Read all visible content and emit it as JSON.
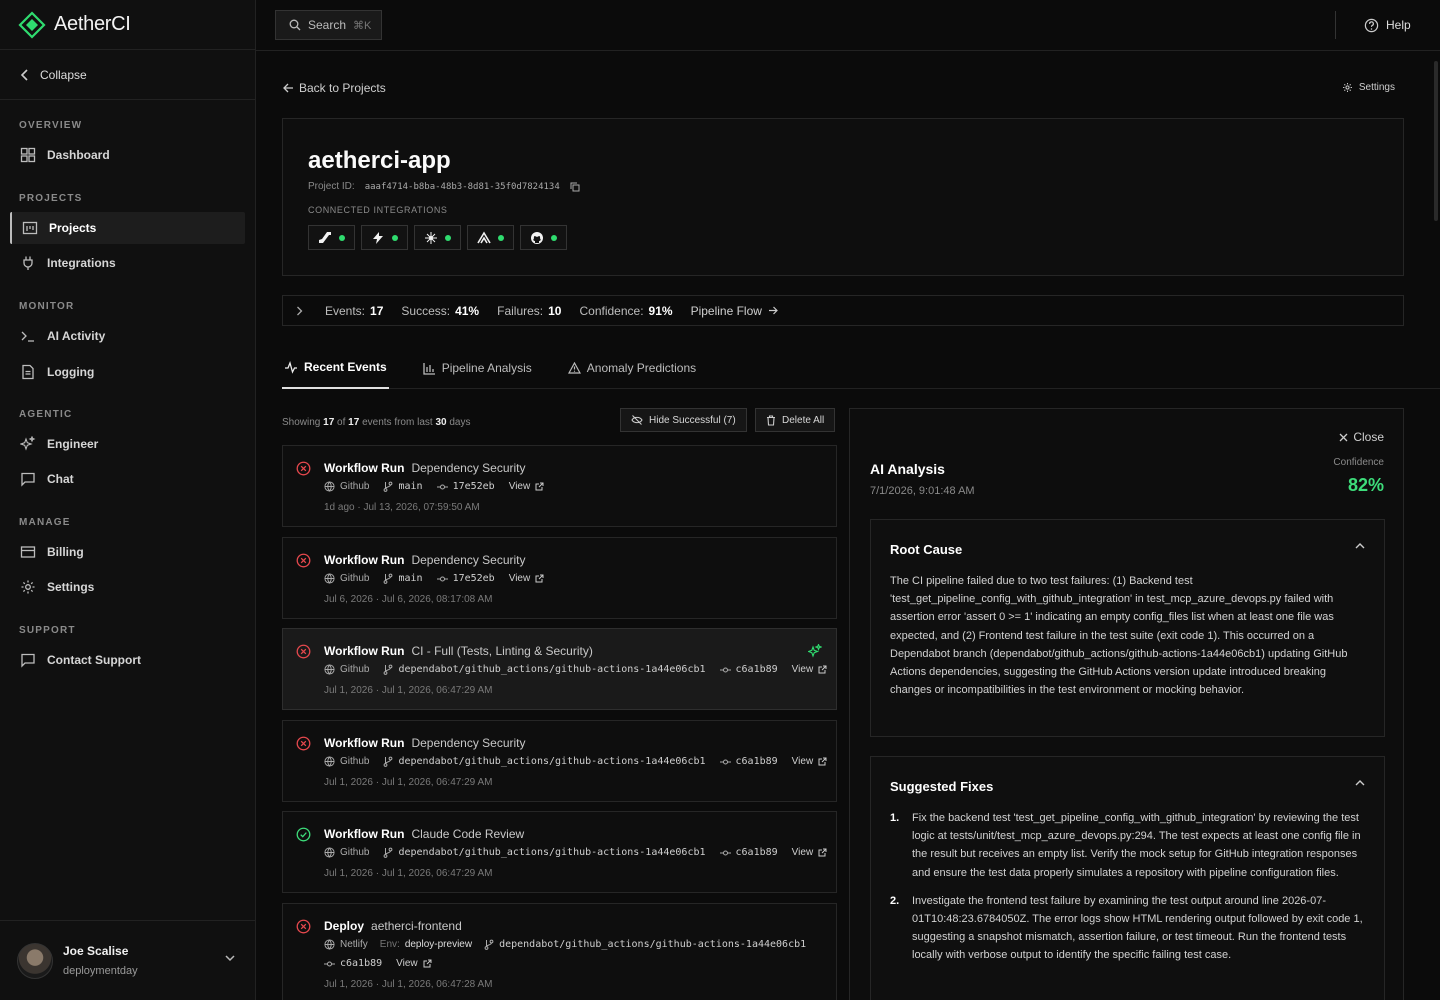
{
  "brand": {
    "name": "AetherCI",
    "logo_icon": "diamond-logo-icon",
    "accent": "#2fdc6f"
  },
  "sidebar": {
    "collapse_label": "Collapse",
    "sections": [
      {
        "heading": "OVERVIEW",
        "items": [
          {
            "label": "Dashboard",
            "icon": "dashboard-icon"
          }
        ]
      },
      {
        "heading": "PROJECTS",
        "items": [
          {
            "label": "Projects",
            "icon": "projects-icon",
            "active": true
          },
          {
            "label": "Integrations",
            "icon": "plug-icon"
          }
        ]
      },
      {
        "heading": "MONITOR",
        "items": [
          {
            "label": "AI Activity",
            "icon": "terminal-icon"
          },
          {
            "label": "Logging",
            "icon": "document-icon"
          }
        ]
      },
      {
        "heading": "AGENTIC",
        "items": [
          {
            "label": "Engineer",
            "icon": "sparkle-icon"
          },
          {
            "label": "Chat",
            "icon": "chat-icon"
          }
        ]
      },
      {
        "heading": "MANAGE",
        "items": [
          {
            "label": "Billing",
            "icon": "card-icon"
          },
          {
            "label": "Settings",
            "icon": "gear-icon"
          }
        ]
      },
      {
        "heading": "SUPPORT",
        "items": [
          {
            "label": "Contact Support",
            "icon": "message-icon"
          }
        ]
      }
    ],
    "user": {
      "name": "Joe Scalise",
      "workspace": "deploymentday"
    }
  },
  "topbar": {
    "search_label": "Search",
    "search_shortcut": "⌘K",
    "help_label": "Help"
  },
  "page": {
    "back_label": "Back to Projects",
    "settings_label": "Settings",
    "project": {
      "name": "aetherci-app",
      "id_label": "Project ID:",
      "id_value": "aaaf4714-b8ba-48b3-8d81-35f0d7824134",
      "integrations_label": "CONNECTED INTEGRATIONS",
      "integrations": [
        {
          "icon": "azure-devops-icon",
          "status": "connected"
        },
        {
          "icon": "bolt-icon",
          "status": "connected"
        },
        {
          "icon": "spark-icon",
          "status": "connected"
        },
        {
          "icon": "sentry-icon",
          "status": "connected"
        },
        {
          "icon": "github-icon",
          "status": "connected"
        }
      ]
    },
    "stats": {
      "events_label": "Events:",
      "events_value": "17",
      "success_label": "Success:",
      "success_value": "41%",
      "failures_label": "Failures:",
      "failures_value": "10",
      "confidence_label": "Confidence:",
      "confidence_value": "91%",
      "pipeline_flow_label": "Pipeline Flow"
    },
    "tabs": [
      {
        "label": "Recent Events",
        "icon": "activity-icon",
        "active": true
      },
      {
        "label": "Pipeline Analysis",
        "icon": "bar-chart-icon"
      },
      {
        "label": "Anomaly Predictions",
        "icon": "warning-icon"
      }
    ],
    "list": {
      "showing_prefix": "Showing",
      "showing_count": "17",
      "showing_of": "of",
      "showing_total": "17",
      "showing_mid": "events from last",
      "showing_days": "30",
      "showing_suffix": "days",
      "hide_successful_label": "Hide Successful (7)",
      "delete_all_label": "Delete All"
    },
    "events": [
      {
        "status": "failed",
        "type": "Workflow Run",
        "name": "Dependency Security",
        "provider": "Github",
        "branch": "main",
        "commit": "17e52eb",
        "view": "View",
        "relative": "1d ago",
        "timestamp": "Jul 13, 2026, 07:59:50 AM"
      },
      {
        "status": "failed",
        "type": "Workflow Run",
        "name": "Dependency Security",
        "provider": "Github",
        "branch": "main",
        "commit": "17e52eb",
        "view": "View",
        "relative": "Jul 6, 2026",
        "timestamp": "Jul 6, 2026, 08:17:08 AM"
      },
      {
        "status": "failed",
        "type": "Workflow Run",
        "name": "CI - Full (Tests, Linting & Security)",
        "provider": "Github",
        "branch": "dependabot/github_actions/github-actions-1a44e06cb1",
        "commit": "c6a1b89",
        "view": "View",
        "relative": "Jul 1, 2026",
        "timestamp": "Jul 1, 2026, 06:47:29 AM",
        "analyzed": true
      },
      {
        "status": "failed",
        "type": "Workflow Run",
        "name": "Dependency Security",
        "provider": "Github",
        "branch": "dependabot/github_actions/github-actions-1a44e06cb1",
        "commit": "c6a1b89",
        "view": "View",
        "relative": "Jul 1, 2026",
        "timestamp": "Jul 1, 2026, 06:47:29 AM"
      },
      {
        "status": "success",
        "type": "Workflow Run",
        "name": "Claude Code Review",
        "provider": "Github",
        "branch": "dependabot/github_actions/github-actions-1a44e06cb1",
        "commit": "c6a1b89",
        "view": "View",
        "relative": "Jul 1, 2026",
        "timestamp": "Jul 1, 2026, 06:47:29 AM"
      },
      {
        "status": "failed",
        "type": "Deploy",
        "name": "aetherci-frontend",
        "provider": "Netlify",
        "env_label": "Env:",
        "env": "deploy-preview",
        "branch": "dependabot/github_actions/github-actions-1a44e06cb1",
        "commit": "c6a1b89",
        "view": "View",
        "relative": "Jul 1, 2026",
        "timestamp": "Jul 1, 2026, 06:47:28 AM"
      }
    ],
    "ai": {
      "close_label": "Close",
      "title": "AI Analysis",
      "date": "7/1/2026, 9:01:48 AM",
      "confidence_label": "Confidence",
      "confidence_value": "82%",
      "root_cause_title": "Root Cause",
      "root_cause": "The CI pipeline failed due to two test failures: (1) Backend test 'test_get_pipeline_config_with_github_integration' in test_mcp_azure_devops.py failed with assertion error 'assert 0 >= 1' indicating an empty config_files list when at least one file was expected, and (2) Frontend test failure in the test suite (exit code 1). This occurred on a Dependabot branch (dependabot/github_actions/github-actions-1a44e06cb1) updating GitHub Actions dependencies, suggesting the GitHub Actions version update introduced breaking changes or incompatibilities in the test environment or mocking behavior.",
      "fixes_title": "Suggested Fixes",
      "fixes": [
        {
          "num": "1.",
          "text": "Fix the backend test 'test_get_pipeline_config_with_github_integration' by reviewing the test logic at tests/unit/test_mcp_azure_devops.py:294. The test expects at least one config file in the result but receives an empty list. Verify the mock setup for GitHub integration responses and ensure the test data properly simulates a repository with pipeline configuration files."
        },
        {
          "num": "2.",
          "text": "Investigate the frontend test failure by examining the test output around line 2026-07-01T10:48:23.6784050Z. The error logs show HTML rendering output followed by exit code 1, suggesting a snapshot mismatch, assertion failure, or test timeout. Run the frontend tests locally with verbose output to identify the specific failing test case."
        }
      ]
    }
  }
}
